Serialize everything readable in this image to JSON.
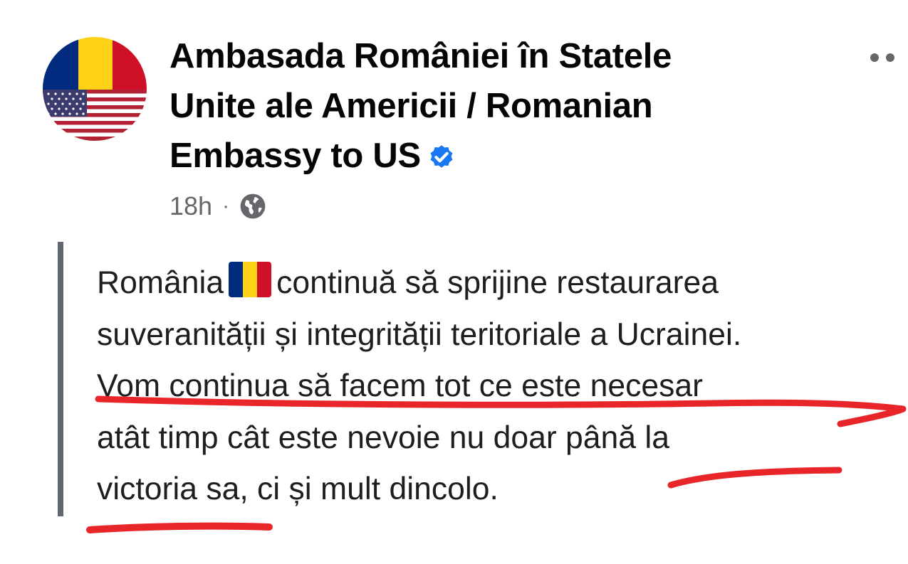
{
  "post": {
    "author": {
      "name_lines": [
        "Ambasada României în Statele",
        "Unite ale Americii / Romanian",
        "Embassy to US"
      ],
      "verified_icon": "verified-badge-icon",
      "avatar_icon": "romania-usa-flags-avatar"
    },
    "meta": {
      "time": "18h",
      "separator": "·",
      "audience_icon": "globe-icon"
    },
    "more_icon": "ellipsis-icon",
    "body": {
      "line1_before": "România",
      "line1_emoji": "romania-flag-emoji",
      "line1_after": "continuă să sprijine restaurarea",
      "line2": "suveranității și integrității teritoriale a Ucrainei.",
      "line3": "Vom continua să facem tot ce este necesar",
      "line4": "atât timp cât este nevoie nu doar până la",
      "line5": "victoria sa, ci și mult dincolo."
    },
    "colors": {
      "text": "#1c1e21",
      "meta": "#65676b",
      "verified": "#1877f2",
      "quote_bar": "#606770",
      "annotation": "#e8262a",
      "flag_blue": "#002b7f",
      "flag_yellow": "#fcd116",
      "flag_red": "#ce1126"
    }
  }
}
